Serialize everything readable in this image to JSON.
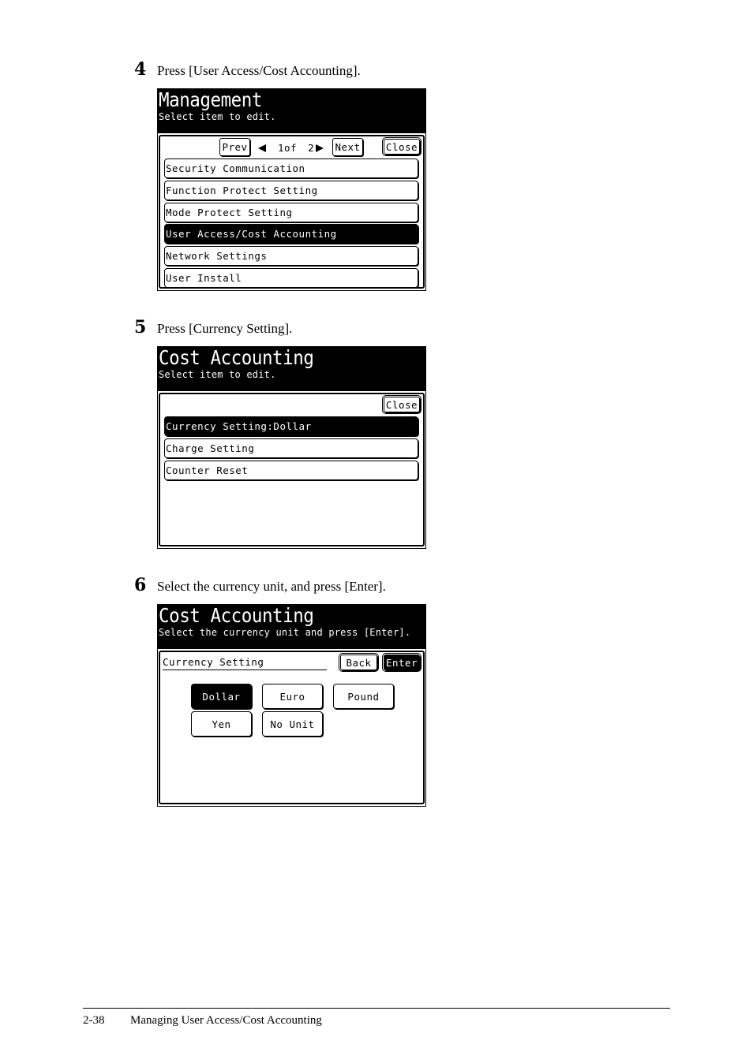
{
  "steps": [
    {
      "number": "4",
      "instruction": "Press [User Access/Cost Accounting].",
      "screen": {
        "title": "Management",
        "subtitle": "Select item to edit.",
        "toolbar": {
          "prev_label": "Prev",
          "page_current": "1of",
          "page_total": "2",
          "next_label": "Next",
          "close_label": "Close"
        },
        "items": [
          {
            "label": "Security Communication",
            "selected": false
          },
          {
            "label": "Function Protect Setting",
            "selected": false
          },
          {
            "label": "Mode Protect Setting",
            "selected": false
          },
          {
            "label": "User Access/Cost Accounting",
            "selected": true
          },
          {
            "label": "Network Settings",
            "selected": false
          },
          {
            "label": "User Install",
            "selected": false
          }
        ]
      }
    },
    {
      "number": "5",
      "instruction": "Press [Currency Setting].",
      "screen": {
        "title": "Cost Accounting",
        "subtitle": "Select item to edit.",
        "toolbar": {
          "close_label": "Close"
        },
        "items": [
          {
            "label": "Currency Setting:Dollar",
            "selected": true
          },
          {
            "label": "Charge Setting",
            "selected": false
          },
          {
            "label": "Counter Reset",
            "selected": false
          }
        ]
      }
    },
    {
      "number": "6",
      "instruction": "Select the currency unit, and press [Enter].",
      "screen": {
        "title": "Cost Accounting",
        "subtitle": "Select the currency unit and press [Enter].",
        "field_label": "Currency Setting",
        "back_label": "Back",
        "enter_label": "Enter",
        "options": [
          {
            "label": "Dollar",
            "selected": true
          },
          {
            "label": "Euro",
            "selected": false
          },
          {
            "label": "Pound",
            "selected": false
          },
          {
            "label": "Yen",
            "selected": false
          },
          {
            "label": "No Unit",
            "selected": false
          }
        ]
      }
    }
  ],
  "footer": {
    "page_number": "2-38",
    "section_title": "Managing User Access/Cost Accounting"
  }
}
